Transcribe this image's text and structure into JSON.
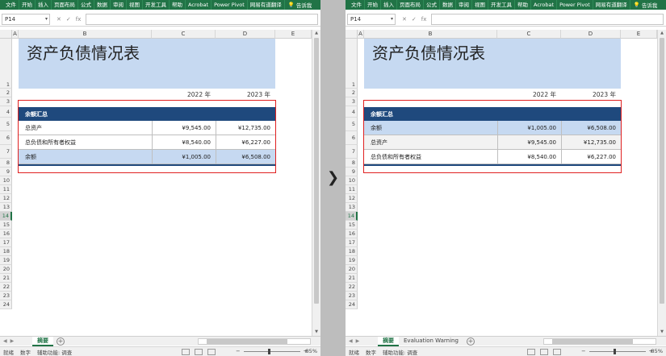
{
  "ribbon_tabs": [
    "文件",
    "开始",
    "插入",
    "页面布局",
    "公式",
    "数据",
    "审阅",
    "视图",
    "开发工具",
    "帮助",
    "Acrobat",
    "Power Pivot",
    "网易有道翻译"
  ],
  "tell_me": "告诉我",
  "name_box": "P14",
  "fx_label": "fx",
  "cancel_icon": "✕",
  "enter_icon": "✓",
  "columns": [
    "A",
    "B",
    "C",
    "D",
    "E"
  ],
  "rows": [
    "1",
    "2",
    "3",
    "4",
    "5",
    "6",
    "7",
    "8",
    "9",
    "10",
    "11",
    "12",
    "13",
    "14",
    "15",
    "16",
    "17",
    "18",
    "19",
    "20",
    "21",
    "22",
    "23",
    "24"
  ],
  "selected_row": "14",
  "title": "资产负债情况表",
  "years": [
    "2022 年",
    "2023 年"
  ],
  "left": {
    "header": "余额汇总",
    "rows": [
      {
        "label": "总资产",
        "v2022": "¥9,545.00",
        "v2023": "¥12,735.00"
      },
      {
        "label": "总负债和所有者权益",
        "v2022": "¥8,540.00",
        "v2023": "¥6,227.00"
      },
      {
        "label": "余额",
        "v2022": "¥1,005.00",
        "v2023": "¥6,508.00"
      }
    ],
    "sheet_tabs": [
      "摘要"
    ]
  },
  "right": {
    "header": "余额汇总",
    "rows": [
      {
        "label": "余额",
        "v2022": "¥1,005.00",
        "v2023": "¥6,508.00"
      },
      {
        "label": "总资产",
        "v2022": "¥9,545.00",
        "v2023": "¥12,735.00"
      },
      {
        "label": "总负债和所有者权益",
        "v2022": "¥8,540.00",
        "v2023": "¥6,227.00"
      }
    ],
    "sheet_tabs": [
      "摘要",
      "Evaluation Warning"
    ]
  },
  "status": {
    "ready": "就绪",
    "mode": "数字",
    "accessibility": "辅助功能: 调查",
    "zoom": "85%"
  },
  "colors": {
    "ribbon": "#217346",
    "title_fill": "#c6d9f1",
    "header_fill": "#1f497d",
    "band_fill": "#c6d9f1",
    "alt_fill": "#f2f2f2",
    "highlight_border": "#e02020"
  },
  "compare_arrow": "❯"
}
